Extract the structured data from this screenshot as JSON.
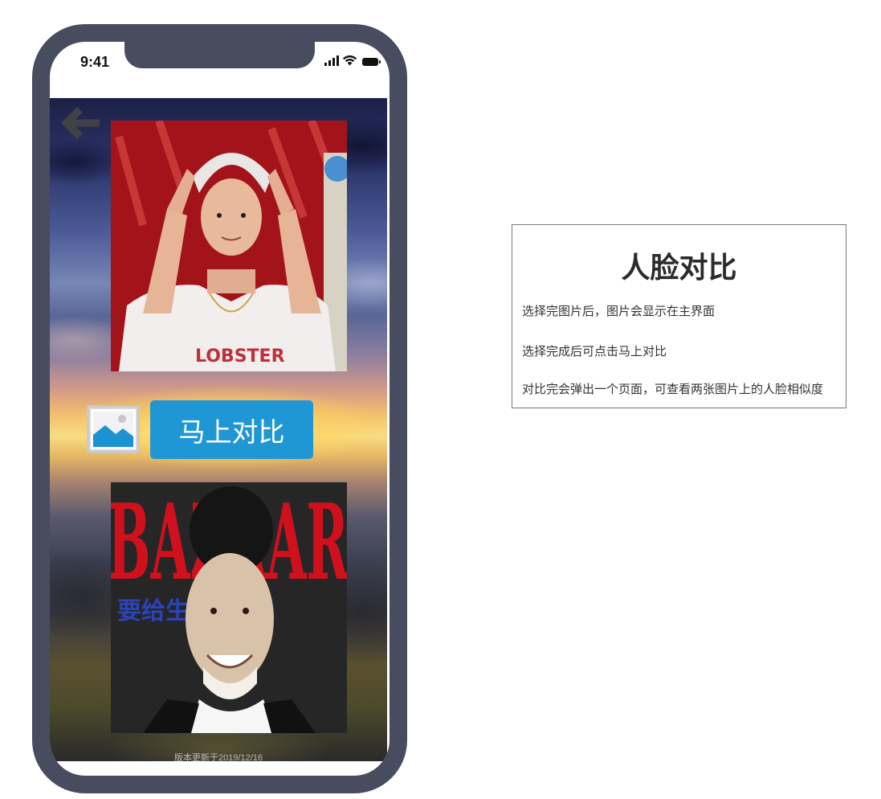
{
  "status_bar": {
    "time": "9:41"
  },
  "main": {
    "compare_button_label": "马上对比",
    "version_text": "版本更新于2019/12/16",
    "top_photo": {
      "shirt_text": "LOBSTER"
    },
    "bottom_photo": {
      "magazine_masthead": "BAZAAR",
      "overlay_text": "要给生命"
    }
  },
  "description": {
    "title": "人脸对比",
    "lines": [
      "选择完图片后，图片会显示在主界面",
      "选择完成后可点击马上对比",
      "对比完会弹出一个页面，可查看两张图片上的人脸相似度"
    ]
  },
  "colors": {
    "phone_frame": "#474c5e",
    "button_blue": "#1f97d4",
    "arrow": "#404247"
  },
  "icons": [
    "back-arrow-icon",
    "image-placeholder-icon",
    "signal-icon",
    "wifi-icon",
    "battery-icon"
  ]
}
